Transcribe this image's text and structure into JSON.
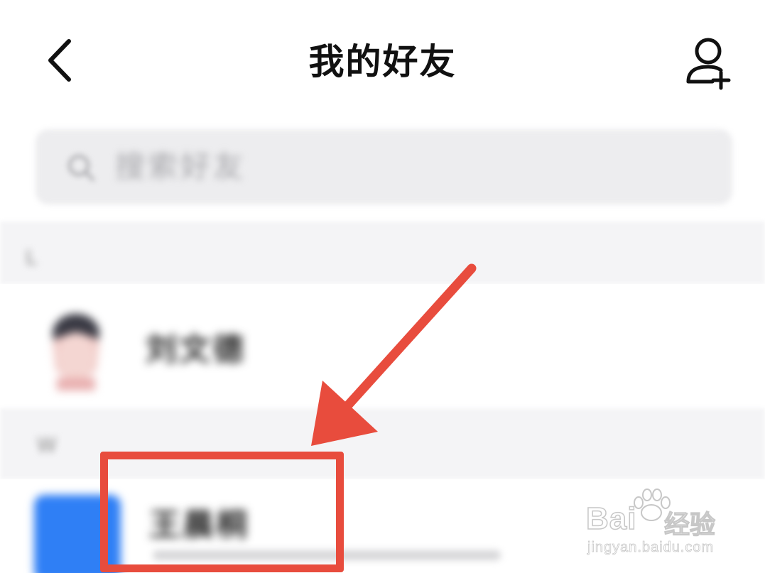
{
  "header": {
    "title": "我的好友",
    "back_icon": "chevron-left-icon",
    "add_friend_icon": "add-user-icon"
  },
  "search": {
    "placeholder": "搜索好友",
    "icon": "search-icon"
  },
  "sections": [
    {
      "letter": "L",
      "friends": [
        {
          "name": "刘文德",
          "avatar": "photo-avatar"
        }
      ]
    },
    {
      "letter": "W",
      "friends": [
        {
          "name": "王晨桐",
          "avatar": "blue-avatar",
          "avatar_text": ""
        }
      ]
    }
  ],
  "annotation": {
    "color": "#e84c3d",
    "arrow_icon": "arrow-down-left-icon"
  },
  "watermark": {
    "brand": "Bai",
    "suffix": "经验",
    "url": "jingyan.baidu.com"
  },
  "colors": {
    "accent_blue": "#2f7ff5",
    "annotation_red": "#e84c3d",
    "section_bg": "#f4f4f6"
  }
}
